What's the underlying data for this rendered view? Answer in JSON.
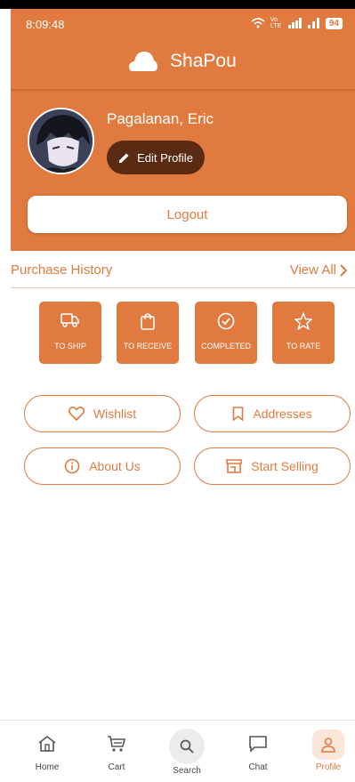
{
  "status_bar": {
    "time": "8:09:48",
    "network_label": "Vo LTE",
    "battery": "94"
  },
  "app": {
    "name": "ShaPou"
  },
  "profile": {
    "name": "Pagalanan, Eric",
    "edit_label": "Edit Profile",
    "logout_label": "Logout"
  },
  "purchase_history": {
    "title": "Purchase History",
    "view_all": "View All"
  },
  "orders": [
    {
      "label": "TO SHIP",
      "icon": "truck-icon"
    },
    {
      "label": "TO RECEIVE",
      "icon": "shopping-bag-icon"
    },
    {
      "label": "COMPLETED",
      "icon": "check-circle-icon"
    },
    {
      "label": "TO RATE",
      "icon": "star-icon"
    }
  ],
  "actions": [
    {
      "label": "Wishlist",
      "icon": "heart-icon"
    },
    {
      "label": "Addresses",
      "icon": "bookmark-icon"
    },
    {
      "label": "About Us",
      "icon": "info-icon"
    },
    {
      "label": "Start Selling",
      "icon": "storefront-icon"
    }
  ],
  "nav": [
    {
      "label": "Home",
      "icon": "home-icon"
    },
    {
      "label": "Cart",
      "icon": "cart-icon"
    },
    {
      "label": "Search",
      "icon": "search-icon"
    },
    {
      "label": "Chat",
      "icon": "chat-icon"
    },
    {
      "label": "Profile",
      "icon": "person-icon",
      "active": true
    }
  ],
  "colors": {
    "accent": "#e07a3f",
    "accent_dark": "#5a2a12",
    "active_nav_bg": "#fbe6da"
  }
}
